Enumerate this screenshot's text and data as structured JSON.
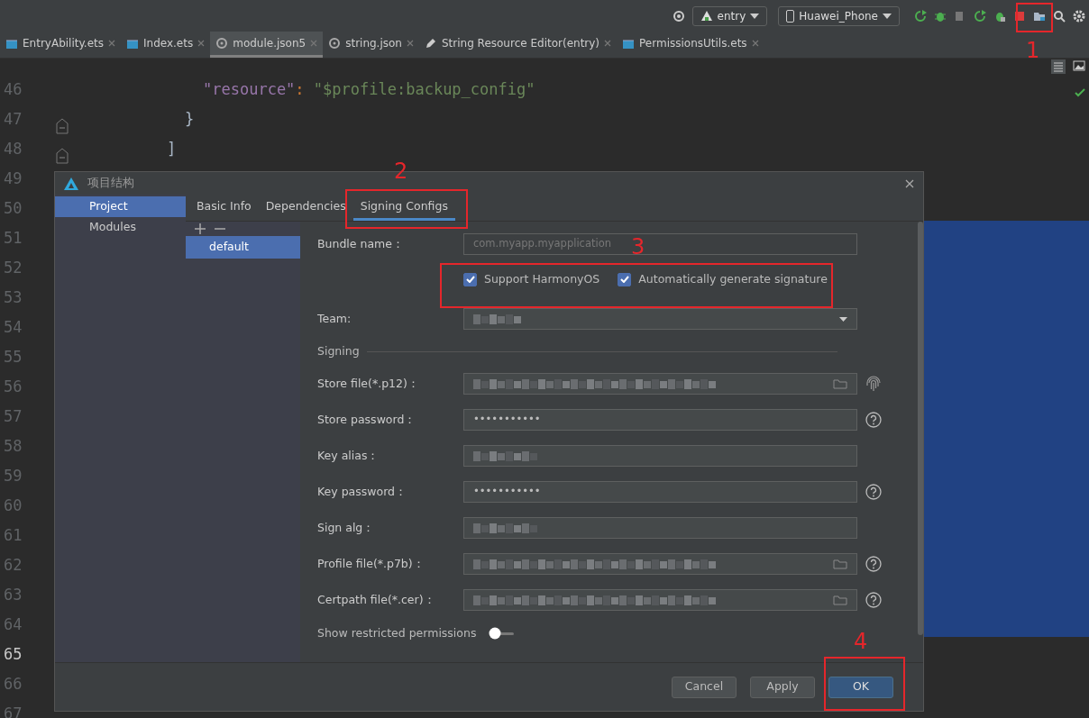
{
  "toolbar": {
    "target": "entry",
    "device": "Huawei_Phone"
  },
  "tabs": [
    {
      "label": "EntryAbility.ets",
      "kind": "ets",
      "selected": false
    },
    {
      "label": "Index.ets",
      "kind": "ets",
      "selected": false
    },
    {
      "label": "module.json5",
      "kind": "json",
      "selected": true
    },
    {
      "label": "string.json",
      "kind": "json",
      "selected": false
    },
    {
      "label": "String Resource Editor(entry)",
      "kind": "editor",
      "selected": false
    },
    {
      "label": "PermissionsUtils.ets",
      "kind": "ets",
      "selected": false
    }
  ],
  "editor": {
    "gutter": [
      {
        "number": "46",
        "current": false,
        "fold": false
      },
      {
        "number": "47",
        "current": false,
        "fold": true
      },
      {
        "number": "48",
        "current": false,
        "fold": true
      },
      {
        "number": "49",
        "current": false
      },
      {
        "number": "50",
        "current": false
      },
      {
        "number": "51",
        "current": false
      },
      {
        "number": "52",
        "current": false
      },
      {
        "number": "53",
        "current": false
      },
      {
        "number": "54",
        "current": false
      },
      {
        "number": "55",
        "current": false
      },
      {
        "number": "56",
        "current": false
      },
      {
        "number": "57",
        "current": false
      },
      {
        "number": "58",
        "current": false
      },
      {
        "number": "59",
        "current": false
      },
      {
        "number": "60",
        "current": false
      },
      {
        "number": "61",
        "current": false
      },
      {
        "number": "62",
        "current": false
      },
      {
        "number": "63",
        "current": false
      },
      {
        "number": "64",
        "current": false
      },
      {
        "number": "65",
        "current": true
      },
      {
        "number": "66",
        "current": false
      },
      {
        "number": "67",
        "current": false
      }
    ],
    "code": [
      {
        "closing": [
          {
            "text": "]",
            "kind": "plain"
          }
        ],
        "children": [
          {
            "closing": [
              {
                "text": "}",
                "kind": "plain"
              }
            ],
            "children": [
              {
                "tokens": [
                  {
                    "text": "\"resource\"",
                    "kind": "key"
                  },
                  {
                    "text": ": ",
                    "kind": "punct"
                  },
                  {
                    "text": "\"$profile:backup_config\"",
                    "kind": "string"
                  }
                ]
              }
            ]
          }
        ]
      }
    ]
  },
  "dialog": {
    "title": "项目结构",
    "nav": [
      {
        "label": "Project",
        "selected": true
      },
      {
        "label": "Modules",
        "selected": false
      }
    ],
    "tabs": [
      {
        "label": "Basic Info",
        "selected": false
      },
      {
        "label": "Dependencies",
        "selected": false
      },
      {
        "label": "Signing Configs",
        "selected": true
      }
    ],
    "configs": [
      {
        "label": "default",
        "selected": true
      }
    ],
    "fields": [
      {
        "kind": "text",
        "label": "Bundle name：",
        "value": "com.myapp.myapplication",
        "disabled": true
      },
      {
        "kind": "checkboxes",
        "items": [
          {
            "label": "Support HarmonyOS",
            "checked": true
          },
          {
            "label": "Automatically generate signature",
            "checked": true
          }
        ]
      },
      {
        "kind": "select",
        "label": "Team:",
        "redacted": true
      },
      {
        "kind": "section",
        "label": "Signing"
      },
      {
        "kind": "file",
        "label": "Store file(*.p12)：",
        "redacted": true,
        "fingerprint": true
      },
      {
        "kind": "text",
        "label": "Store password：",
        "value": "•••••••••••",
        "help": true
      },
      {
        "kind": "text",
        "label": "Key alias：",
        "redacted": true
      },
      {
        "kind": "text",
        "label": "Key password：",
        "value": "•••••••••••",
        "help": true
      },
      {
        "kind": "text",
        "label": "Sign alg：",
        "redacted": true
      },
      {
        "kind": "file",
        "label": "Profile file(*.p7b)：",
        "redacted": true,
        "help": true
      },
      {
        "kind": "file",
        "label": "Certpath file(*.cer)：",
        "redacted": true,
        "help": true
      },
      {
        "kind": "toggle",
        "label": "Show restricted permissions",
        "on": false
      }
    ],
    "buttons": [
      {
        "label": "Cancel",
        "primary": false
      },
      {
        "label": "Apply",
        "primary": false
      },
      {
        "label": "OK",
        "primary": true
      }
    ]
  },
  "annotations": [
    {
      "number": "1"
    },
    {
      "number": "2"
    },
    {
      "number": "3"
    },
    {
      "number": "4"
    }
  ]
}
